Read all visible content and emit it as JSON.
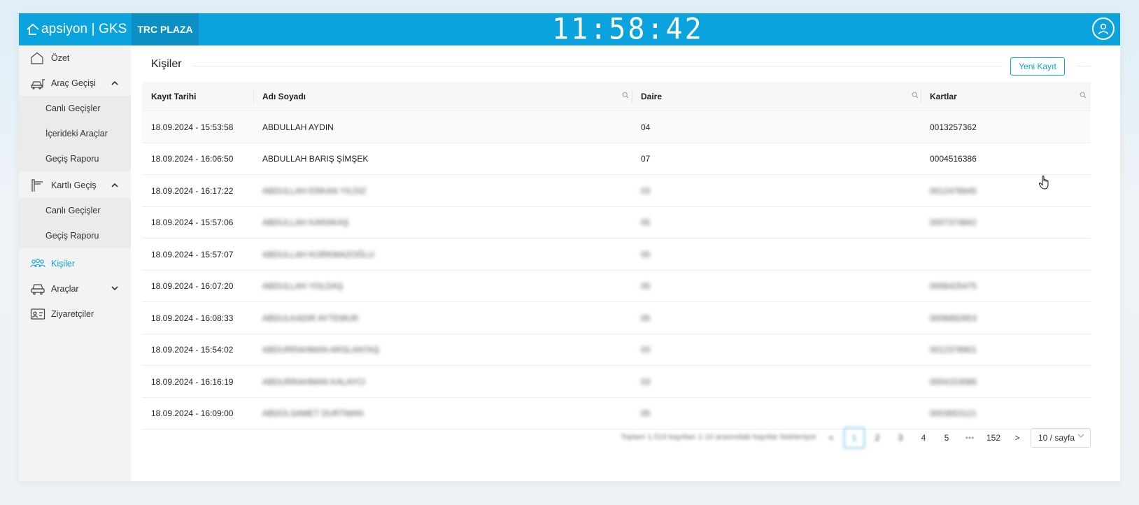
{
  "header": {
    "brand": "apsiyon | GKS",
    "site": "TRC PLAZA",
    "clock": "11:58:42"
  },
  "sidebar": {
    "items": [
      {
        "label": "Özet",
        "icon": "home-icon"
      },
      {
        "label": "Araç Geçişi",
        "icon": "car-gate-icon",
        "expanded": true,
        "children": [
          "Canlı Geçişler",
          "İçerideki Araçlar",
          "Geçiş Raporu"
        ]
      },
      {
        "label": "Kartlı Geçiş",
        "icon": "turnstile-icon",
        "expanded": true,
        "children": [
          "Canlı Geçişler",
          "Geçiş Raporu"
        ]
      },
      {
        "label": "Kişiler",
        "icon": "people-icon",
        "active": true
      },
      {
        "label": "Araçlar",
        "icon": "car-icon",
        "expanded": false
      },
      {
        "label": "Ziyaretçiler",
        "icon": "visitor-card-icon"
      }
    ],
    "chevron_up": "⌃",
    "chevron_down": "⌄"
  },
  "main": {
    "title": "Kişiler",
    "new_button": "Yeni Kayıt",
    "columns": [
      "Kayıt Tarihi",
      "Adı Soyadı",
      "Daire",
      "Kartlar"
    ],
    "rows": [
      {
        "date": "18.09.2024 - 15:53:58",
        "name": "ABDULLAH AYDIN",
        "unit": "04",
        "card": "0013257362",
        "blurred": false
      },
      {
        "date": "18.09.2024 - 16:06:50",
        "name": "ABDULLAH BARIŞ ŞİMŞEK",
        "unit": "07",
        "card": "0004516386",
        "blurred": false
      },
      {
        "date": "18.09.2024 - 16:17:22",
        "name": "ABDULLAH ERKAN YILDIZ",
        "unit": "03",
        "card": "0012476645",
        "blurred": true
      },
      {
        "date": "18.09.2024 - 15:57:06",
        "name": "ABDULLAH KARAKAŞ",
        "unit": "05",
        "card": "0007374842",
        "blurred": true
      },
      {
        "date": "18.09.2024 - 15:57:07",
        "name": "ABDULLAH KORKMAZOĞLU",
        "unit": "05",
        "card": "",
        "blurred": true
      },
      {
        "date": "18.09.2024 - 16:07:20",
        "name": "ABDULLAH YOLDAŞ",
        "unit": "05",
        "card": "0006425475",
        "blurred": true
      },
      {
        "date": "18.09.2024 - 16:08:33",
        "name": "ABDULKADIR AYTEMUR",
        "unit": "05",
        "card": "0006892653",
        "blurred": true
      },
      {
        "date": "18.09.2024 - 15:54:02",
        "name": "ABDURRAHMAN ARSLANTAŞ",
        "unit": "03",
        "card": "0012378901",
        "blurred": true
      },
      {
        "date": "18.09.2024 - 16:16:19",
        "name": "ABDURRAHMAN KALAYCI",
        "unit": "03",
        "card": "0004153086",
        "blurred": true
      },
      {
        "date": "18.09.2024 - 16:09:00",
        "name": "ABDÜLSAMET DURTMAN",
        "unit": "05",
        "card": "0003653121",
        "blurred": true
      }
    ]
  },
  "pagination": {
    "summary": "Toplam 1.519 kayıttan 1-10 arasındaki kayıtlar listeleniyor",
    "prev": "<",
    "pages": [
      "1",
      "2",
      "3",
      "4",
      "5",
      "•••",
      "152"
    ],
    "next": ">",
    "page_size": "10 / sayfa"
  },
  "colors": {
    "accent": "#0aa3dd",
    "header_dark": "#0b8fc4"
  }
}
